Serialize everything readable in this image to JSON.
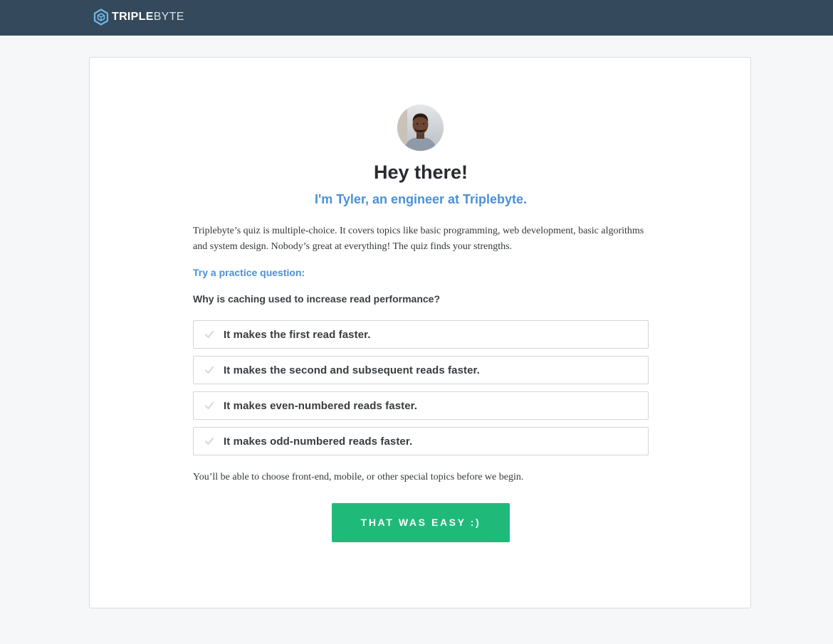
{
  "header": {
    "brand_bold": "TRIPLE",
    "brand_light": "BYTE",
    "logo_icon": "hexagon-cube-icon",
    "background_color": "#34495b"
  },
  "card": {
    "avatar_icon": "person-avatar",
    "heading": "Hey there!",
    "subheading": "I'm Tyler, an engineer at Triplebyte.",
    "intro": "Triplebyte’s quiz is multiple-choice. It covers topics like basic programming, web development, basic algorithms and system design. Nobody’s great at everything! The quiz finds your strengths.",
    "practice_label": "Try a practice question:",
    "question": "Why is caching used to increase read performance?",
    "options": [
      {
        "label": "It makes the first read faster."
      },
      {
        "label": "It makes the second and subsequent reads faster."
      },
      {
        "label": "It makes even-numbered reads faster."
      },
      {
        "label": "It makes odd-numbered reads faster."
      }
    ],
    "footnote": "You’ll be able to choose front-end, mobile, or other special topics before we begin.",
    "cta_label": "THAT WAS EASY :)"
  },
  "colors": {
    "accent_blue": "#4a90d9",
    "cta_green": "#1fba7a",
    "page_background": "#f6f7f9"
  }
}
